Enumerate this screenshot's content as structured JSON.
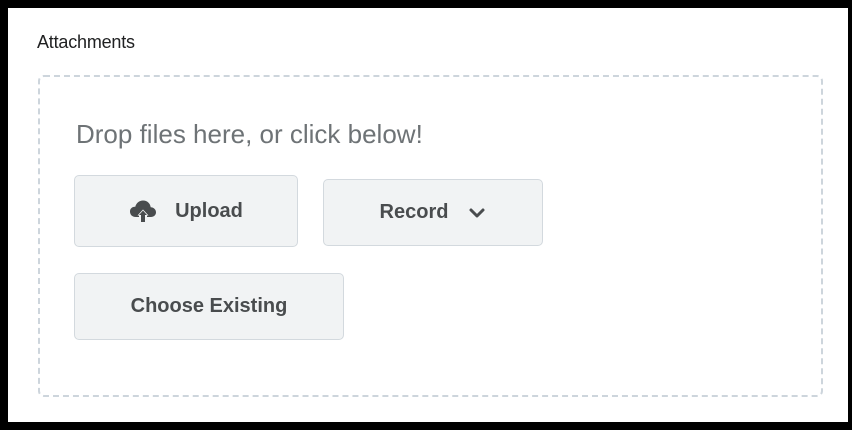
{
  "attachments": {
    "title": "Attachments",
    "dropzone": {
      "text": "Drop files here, or click below!"
    },
    "buttons": {
      "upload": {
        "label": "Upload",
        "icon": "cloud-upload-icon"
      },
      "record": {
        "label": "Record",
        "icon": "chevron-down-icon"
      },
      "choose_existing": {
        "label": "Choose Existing"
      }
    }
  },
  "colors": {
    "border_outer": "#000000",
    "dropzone_border": "#cdd5dc",
    "button_bg": "#f1f3f4",
    "button_border": "#d3d9de",
    "button_text": "#494c4e",
    "drop_text": "#6e7376"
  }
}
